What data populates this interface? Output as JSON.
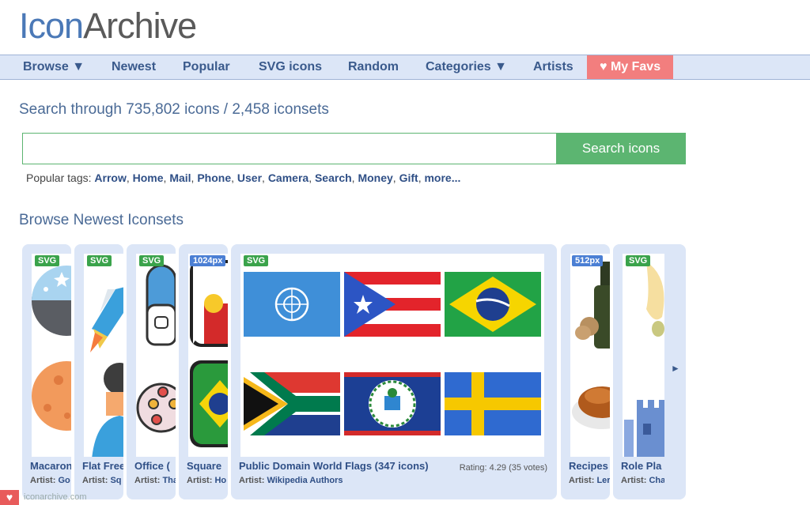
{
  "logo": {
    "part1": "Icon",
    "part2": "Archive"
  },
  "nav": {
    "browse": "Browse ▼",
    "newest": "Newest",
    "popular": "Popular",
    "svg": "SVG icons",
    "random": "Random",
    "categories": "Categories ▼",
    "artists": "Artists",
    "favs": "♥ My Favs"
  },
  "search": {
    "title": "Search through 735,802 icons / 2,458 iconsets",
    "value": "",
    "button": "Search icons",
    "tags_label": "Popular tags:",
    "tags": [
      "Arrow",
      "Home",
      "Mail",
      "Phone",
      "User",
      "Camera",
      "Search",
      "Money",
      "Gift",
      "more..."
    ]
  },
  "browse": {
    "title": "Browse Newest Iconsets",
    "cards": [
      {
        "badge": "SVG",
        "title": "Macaroni",
        "artist_label": "Artist:",
        "artist": "Go"
      },
      {
        "badge": "SVG",
        "title": "Flat Free",
        "artist_label": "Artist:",
        "artist": "Sq"
      },
      {
        "badge": "SVG",
        "title": "Office (",
        "artist_label": "Artist:",
        "artist": "Tha"
      },
      {
        "badge": "1024px",
        "title": "Square",
        "artist_label": "Artist:",
        "artist": "Ho"
      },
      {
        "badge": "SVG",
        "title": "Public Domain World Flags (347 icons)",
        "artist_label": "Artist:",
        "artist": "Wikipedia Authors",
        "rating": "Rating: 4.29 (35 votes)"
      },
      {
        "badge": "512px",
        "title": "Recipes",
        "artist_label": "Artist:",
        "artist": "Ler"
      },
      {
        "badge": "SVG",
        "title": "Role Pla",
        "artist_label": "Artist:",
        "artist": "Cha"
      }
    ],
    "next_arrow": "►"
  },
  "footer": {
    "heart": "♥",
    "text": "iconarchive.com"
  },
  "colors": {
    "nav_bg": "#dce6f7",
    "accent_green": "#5cb571",
    "favs_red": "#f27e7e",
    "link_blue": "#2f4f86"
  }
}
